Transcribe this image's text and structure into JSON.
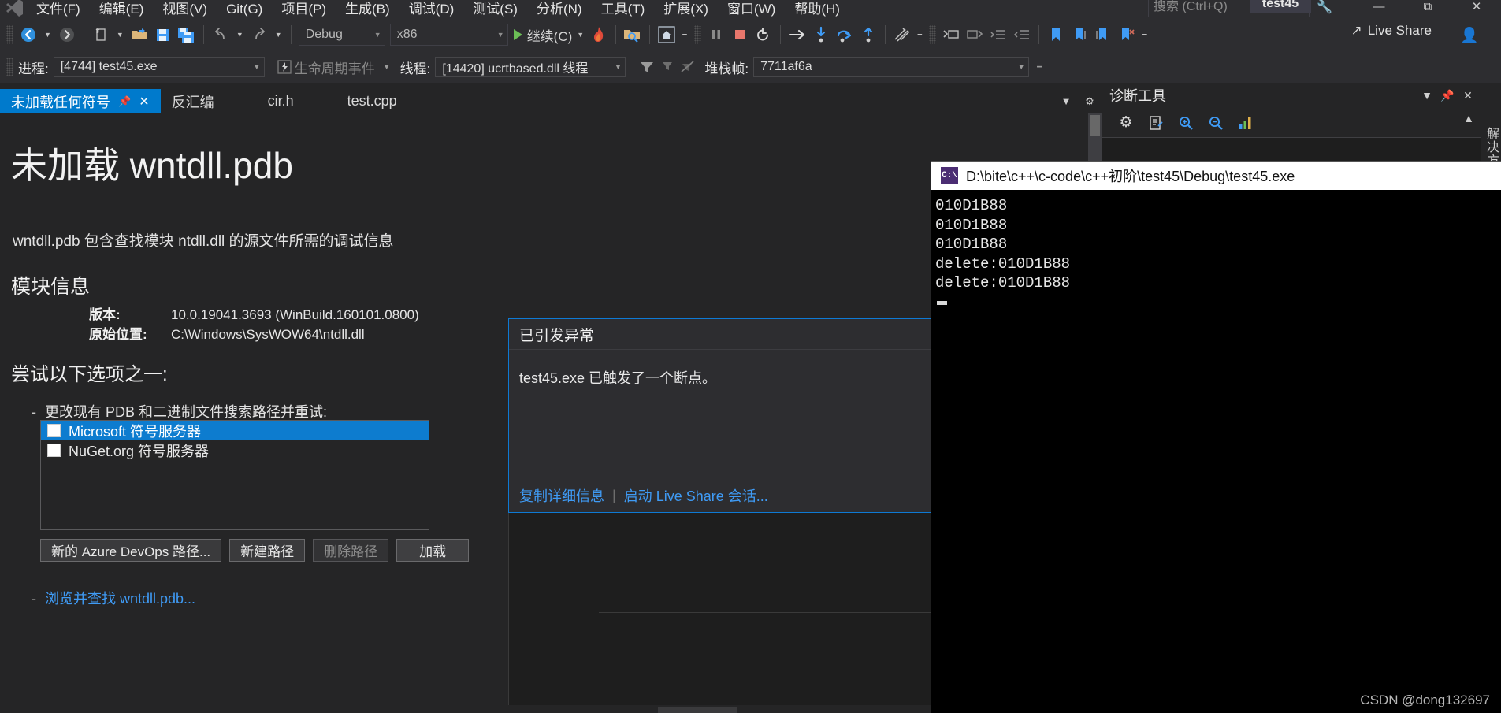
{
  "titlebar": {
    "menus": [
      "文件(F)",
      "编辑(E)",
      "视图(V)",
      "Git(G)",
      "项目(P)",
      "生成(B)",
      "调试(D)",
      "测试(S)",
      "分析(N)",
      "工具(T)",
      "扩展(X)",
      "窗口(W)",
      "帮助(H)"
    ],
    "search_placeholder": "搜索 (Ctrl+Q)",
    "search_value": "",
    "project_badge": "test45",
    "window_buttons": [
      "minimize",
      "restore",
      "close"
    ]
  },
  "toolbar": {
    "back_icon": "back-arrow-icon",
    "forward_icon": "forward-arrow-icon",
    "new_item_icon": "new-item-icon",
    "open_icon": "open-folder-icon",
    "save_icon": "save-icon",
    "save_all_icon": "save-all-icon",
    "undo_icon": "undo-icon",
    "redo_icon": "redo-icon",
    "config": "Debug",
    "platform": "x86",
    "continue_label": "继续(C)",
    "hot_reload_icon": "hot-reload-icon",
    "attach_icon": "attach-to-process-icon",
    "home_icon": "home-icon",
    "pause_icon": "pause-icon",
    "stop_icon": "stop-icon",
    "restart_icon": "restart-icon",
    "step_over_icon": "step-over-icon",
    "step_into_icon": "step-into-icon",
    "step_out_icon": "step-out-icon",
    "step_up_icon": "step-up-icon",
    "live_share": "Live Share",
    "account_icon": "account-icon"
  },
  "debugbar": {
    "process_label": "进程:",
    "process_value": "[4744] test45.exe",
    "lifecycle_icon": "lifecycle-events-icon",
    "lifecycle_label": "生命周期事件",
    "thread_label": "线程:",
    "thread_value": "[14420] ucrtbased.dll 线程",
    "filter_icon": "filter-icon",
    "flag_icon": "flag-icon",
    "noflag_icon": "no-flag-icon",
    "stackframe_label": "堆栈帧:",
    "stackframe_value": "7711af6a"
  },
  "tabs": [
    {
      "label": "未加载任何符号",
      "active": true,
      "pinned": true,
      "closable": true
    },
    {
      "label": "反汇编",
      "active": false
    },
    {
      "label": "cir.h",
      "active": false
    },
    {
      "label": "test.cpp",
      "active": false
    }
  ],
  "document": {
    "heading": "未加载 wntdll.pdb",
    "description": "wntdll.pdb 包含查找模块 ntdll.dll 的源文件所需的调试信息",
    "module_info_heading": "模块信息",
    "fields": [
      {
        "key": "版本:",
        "value": "10.0.19041.3693 (WinBuild.160101.0800)"
      },
      {
        "key": "原始位置:",
        "value": "C:\\Windows\\SysWOW64\\ntdll.dll"
      }
    ],
    "options_heading": "尝试以下选项之一:",
    "option1": "更改现有 PDB 和二进制文件搜索路径并重试:",
    "symbol_servers": [
      {
        "label": "Microsoft 符号服务器",
        "checked": false,
        "selected": true
      },
      {
        "label": "NuGet.org 符号服务器",
        "checked": false,
        "selected": false
      }
    ],
    "buttons": [
      {
        "label": "新的 Azure DevOps 路径...",
        "disabled": false,
        "focused": true
      },
      {
        "label": "新建路径",
        "disabled": false
      },
      {
        "label": "删除路径",
        "disabled": true
      },
      {
        "label": "加载",
        "disabled": false,
        "primary": true
      }
    ],
    "browse_link": "浏览并查找 wntdll.pdb..."
  },
  "exception_dialog": {
    "title": "已引发异常",
    "message": "test45.exe 已触发了一个断点。",
    "copy_link": "复制详细信息",
    "separator": "|",
    "live_share_link": "启动 Live Share 会话..."
  },
  "diagnostics": {
    "title": "诊断工具",
    "settings_icon": "gear-icon",
    "report_icon": "report-icon",
    "zoom_in_icon": "zoom-in-icon",
    "zoom_out_icon": "zoom-out-icon",
    "chart_icon": "chart-icon",
    "dropdown_icon": "chevron-down-icon",
    "pin_icon": "pin-icon",
    "close_icon": "close-icon",
    "expand_icon": "chevron-up-icon"
  },
  "solution_explorer_tab": "解决方案",
  "console": {
    "icon": "cmd-icon",
    "icon_text": "C:\\",
    "title": "D:\\bite\\c++\\c-code\\c++初阶\\test45\\Debug\\test45.exe",
    "lines": [
      "010D1B88",
      "010D1B88",
      "010D1B88",
      "delete:010D1B88",
      "delete:010D1B88"
    ]
  },
  "watermark": "CSDN @dong132697"
}
